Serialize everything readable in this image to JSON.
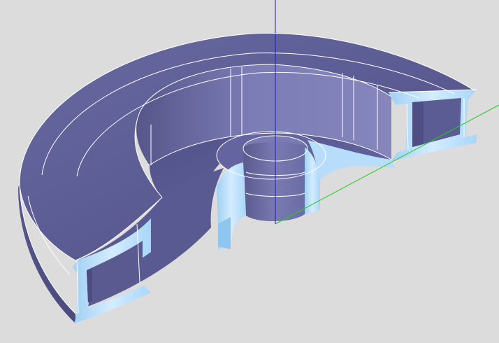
{
  "viewport": {
    "background": "#dcdcdc",
    "colors": {
      "top_face": "#5f5f95",
      "top_face_light": "#6d6da6",
      "inner_wall": "#7878b2",
      "inner_wall_dark": "#5a5a8e",
      "section_face": "#cfe8ff",
      "section_face_mid": "#a9d4f6",
      "outer_wall": "#54548a",
      "edge_line": "#ffffff",
      "axis_x": "#22cc22",
      "axis_z": "#1a1acc"
    },
    "axes": [
      "axis-x",
      "axis-z"
    ]
  }
}
